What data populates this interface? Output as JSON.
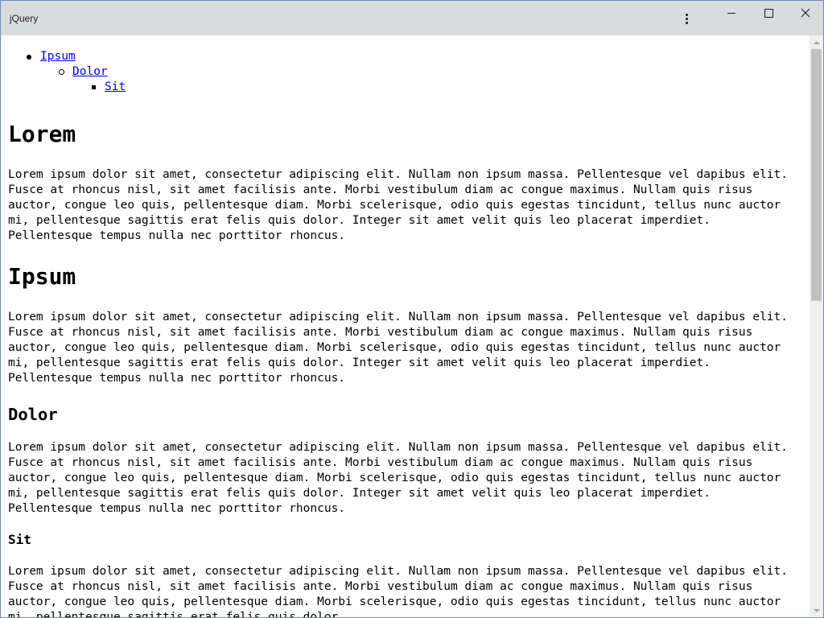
{
  "window": {
    "title": "jQuery",
    "menu_icon": "more-vertical-icon",
    "minimize_icon": "minimize-icon",
    "maximize_icon": "maximize-icon",
    "close_icon": "close-icon"
  },
  "toc": {
    "items": [
      {
        "label": "Ipsum",
        "level": 1
      },
      {
        "label": "Dolor",
        "level": 2
      },
      {
        "label": "Sit",
        "level": 3
      }
    ]
  },
  "sections": [
    {
      "heading": "Lorem",
      "level": 1,
      "text": "Lorem ipsum dolor sit amet, consectetur adipiscing elit. Nullam non ipsum massa. Pellentesque vel dapibus elit. Fusce at rhoncus nisl, sit amet facilisis ante. Morbi vestibulum diam ac congue maximus. Nullam quis risus auctor, congue leo quis, pellentesque diam. Morbi scelerisque, odio quis egestas tincidunt, tellus nunc auctor mi, pellentesque sagittis erat felis quis dolor. Integer sit amet velit quis leo placerat imperdiet. Pellentesque tempus nulla nec porttitor rhoncus."
    },
    {
      "heading": "Ipsum",
      "level": 1,
      "text": "Lorem ipsum dolor sit amet, consectetur adipiscing elit. Nullam non ipsum massa. Pellentesque vel dapibus elit. Fusce at rhoncus nisl, sit amet facilisis ante. Morbi vestibulum diam ac congue maximus. Nullam quis risus auctor, congue leo quis, pellentesque diam. Morbi scelerisque, odio quis egestas tincidunt, tellus nunc auctor mi, pellentesque sagittis erat felis quis dolor. Integer sit amet velit quis leo placerat imperdiet. Pellentesque tempus nulla nec porttitor rhoncus."
    },
    {
      "heading": "Dolor",
      "level": 2,
      "text": "Lorem ipsum dolor sit amet, consectetur adipiscing elit. Nullam non ipsum massa. Pellentesque vel dapibus elit. Fusce at rhoncus nisl, sit amet facilisis ante. Morbi vestibulum diam ac congue maximus. Nullam quis risus auctor, congue leo quis, pellentesque diam. Morbi scelerisque, odio quis egestas tincidunt, tellus nunc auctor mi, pellentesque sagittis erat felis quis dolor. Integer sit amet velit quis leo placerat imperdiet. Pellentesque tempus nulla nec porttitor rhoncus."
    },
    {
      "heading": "Sit",
      "level": 3,
      "text": "Lorem ipsum dolor sit amet, consectetur adipiscing elit. Nullam non ipsum massa. Pellentesque vel dapibus elit. Fusce at rhoncus nisl, sit amet facilisis ante. Morbi vestibulum diam ac congue maximus. Nullam quis risus auctor, congue leo quis, pellentesque diam. Morbi scelerisque, odio quis egestas tincidunt, tellus nunc auctor mi, pellentesque sagittis erat felis quis dolor."
    }
  ],
  "colors": {
    "link": "#0000ee",
    "titlebar": "#dadbdf",
    "scrollbar_thumb": "#c1c1c1"
  }
}
